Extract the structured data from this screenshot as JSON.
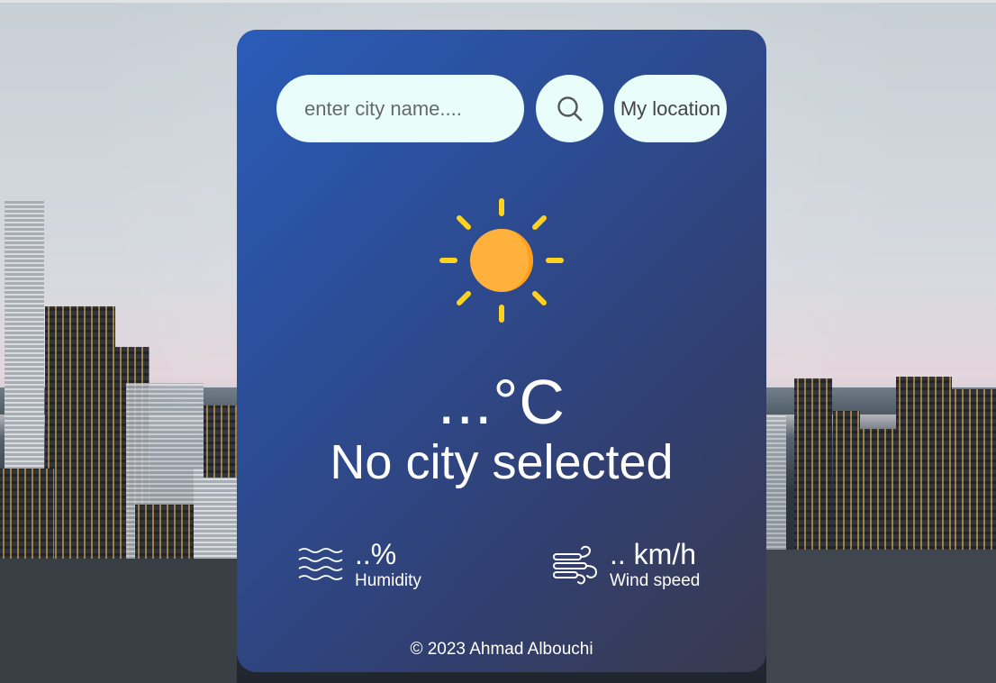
{
  "search": {
    "placeholder": "enter city name....",
    "value": ""
  },
  "buttons": {
    "search_icon": "search-icon",
    "location_label": "My location"
  },
  "weather": {
    "icon": "sun-icon",
    "temperature": "...°C",
    "city": "No city selected"
  },
  "humidity": {
    "icon": "waves-icon",
    "value": "..%",
    "label": "Humidity"
  },
  "wind": {
    "icon": "wind-icon",
    "value": ".. km/h",
    "label": "Wind speed"
  },
  "footer": {
    "text": "© 2023 Ahmad Albouchi"
  },
  "colors": {
    "card_gradient_start": "#2a5cb8",
    "card_gradient_end": "#3a3a4c",
    "input_bg": "#e9fdfb",
    "sun": "#ffb13b",
    "sun_rays": "#ffd21f"
  }
}
